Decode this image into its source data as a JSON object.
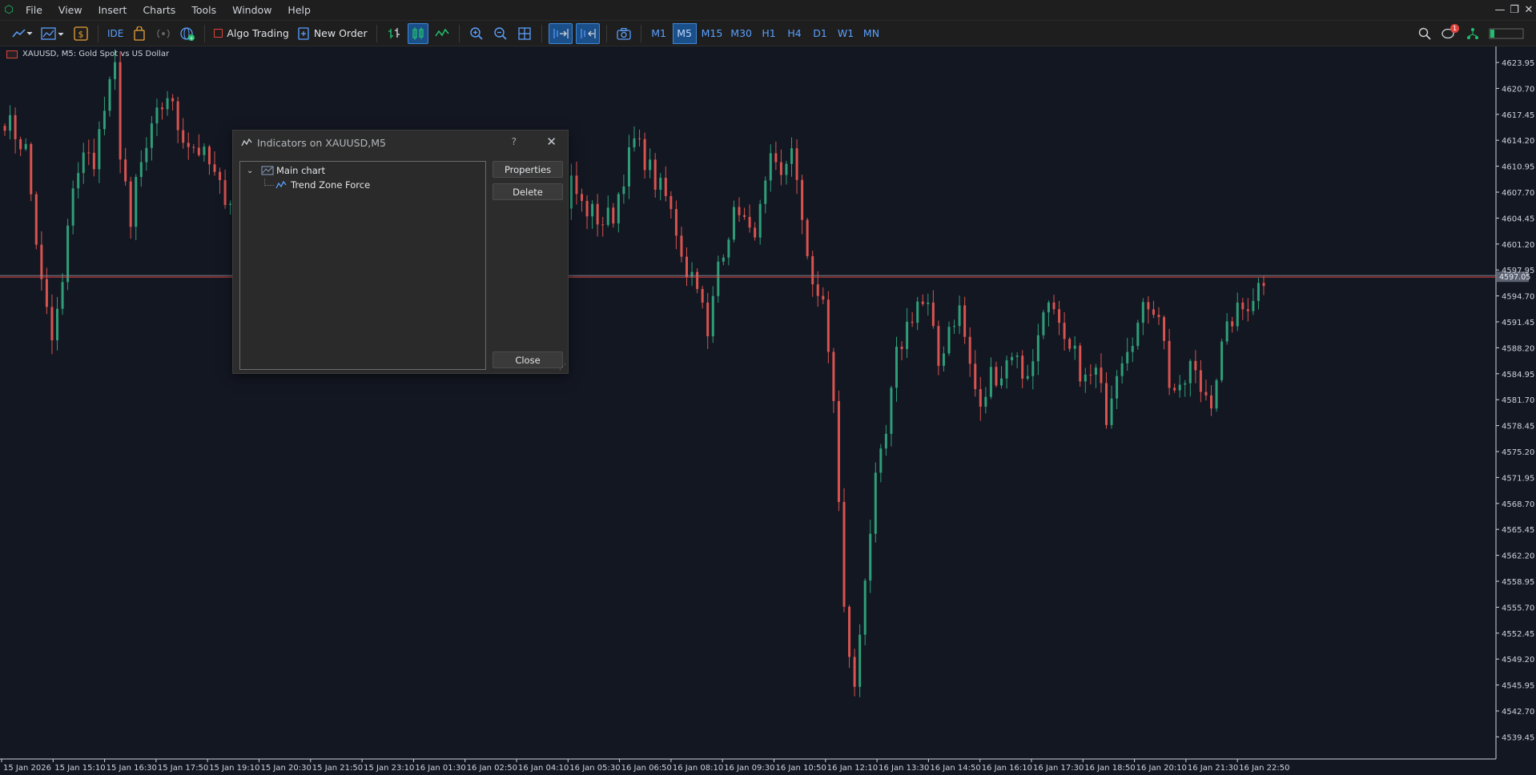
{
  "menubar": {
    "items": [
      "File",
      "View",
      "Insert",
      "Charts",
      "Tools",
      "Window",
      "Help"
    ],
    "window_controls": [
      "—",
      "❐",
      "✕"
    ]
  },
  "toolbar": {
    "ide_label": "IDE",
    "algo_trading_label": "Algo Trading",
    "new_order_label": "New Order",
    "timeframes": [
      "M1",
      "M5",
      "M15",
      "M30",
      "H1",
      "H4",
      "D1",
      "W1",
      "MN"
    ],
    "active_timeframe": "M5",
    "notification_count": "1"
  },
  "chart": {
    "title": "XAUUSD, M5:  Gold Spot vs US Dollar",
    "current_price": "4597.05",
    "price_labels": [
      "4623.95",
      "4620.70",
      "4617.45",
      "4614.20",
      "4610.95",
      "4607.70",
      "4604.45",
      "4601.20",
      "4597.95",
      "4594.70",
      "4591.45",
      "4588.20",
      "4584.95",
      "4581.70",
      "4578.45",
      "4575.20",
      "4571.95",
      "4568.70",
      "4565.45",
      "4562.20",
      "4558.95",
      "4555.70",
      "4552.45",
      "4549.20",
      "4545.95",
      "4542.70",
      "4539.45"
    ],
    "time_labels": [
      "15 Jan 2026",
      "15 Jan 15:10",
      "15 Jan 16:30",
      "15 Jan 17:50",
      "15 Jan 19:10",
      "15 Jan 20:30",
      "15 Jan 21:50",
      "15 Jan 23:10",
      "16 Jan 01:30",
      "16 Jan 02:50",
      "16 Jan 04:10",
      "16 Jan 05:30",
      "16 Jan 06:50",
      "16 Jan 08:10",
      "16 Jan 09:30",
      "16 Jan 10:50",
      "16 Jan 12:10",
      "16 Jan 13:30",
      "16 Jan 14:50",
      "16 Jan 16:10",
      "16 Jan 17:30",
      "16 Jan 18:50",
      "16 Jan 20:10",
      "16 Jan 21:30",
      "16 Jan 22:50"
    ],
    "colors": {
      "bull": "#2f9e78",
      "bear": "#d9534f",
      "background": "#131722",
      "price_line": "#e0433b"
    }
  },
  "chart_data": {
    "type": "candlestick",
    "symbol": "XAUUSD",
    "timeframe": "M5",
    "ylim": [
      4537,
      4626
    ],
    "current_price": 4597.05,
    "path_close": [
      [
        0,
        4617
      ],
      [
        4,
        4613
      ],
      [
        7,
        4596
      ],
      [
        9,
        4589
      ],
      [
        11,
        4596
      ],
      [
        13,
        4609
      ],
      [
        15,
        4612
      ],
      [
        17,
        4612
      ],
      [
        19,
        4618
      ],
      [
        21,
        4623
      ],
      [
        22,
        4613
      ],
      [
        23,
        4609
      ],
      [
        24,
        4602
      ],
      [
        25,
        4609
      ],
      [
        27,
        4613
      ],
      [
        29,
        4617
      ],
      [
        31,
        4620
      ],
      [
        33,
        4616
      ],
      [
        35,
        4614
      ],
      [
        37,
        4613
      ],
      [
        39,
        4611
      ],
      [
        41,
        4608
      ],
      [
        43,
        4607
      ],
      [
        45,
        4604
      ],
      [
        47,
        4602
      ],
      [
        49,
        4603
      ],
      [
        52,
        4598
      ],
      [
        55,
        4597
      ],
      [
        57,
        4598
      ],
      [
        60,
        4600
      ],
      [
        62,
        4598
      ],
      [
        65,
        4599
      ],
      [
        67,
        4601
      ],
      [
        70,
        4599
      ],
      [
        73,
        4597
      ],
      [
        76,
        4595
      ],
      [
        78,
        4592
      ],
      [
        80,
        4596
      ],
      [
        82,
        4611
      ],
      [
        84,
        4608
      ],
      [
        86,
        4605
      ],
      [
        88,
        4597
      ],
      [
        90,
        4599
      ],
      [
        92,
        4607
      ],
      [
        94,
        4609
      ],
      [
        96,
        4607
      ],
      [
        98,
        4605
      ],
      [
        100,
        4603
      ],
      [
        102,
        4602
      ],
      [
        104,
        4601
      ],
      [
        106,
        4604
      ],
      [
        108,
        4609
      ],
      [
        110,
        4606
      ],
      [
        112,
        4605
      ],
      [
        114,
        4604
      ],
      [
        116,
        4605
      ],
      [
        118,
        4610
      ],
      [
        120,
        4614
      ],
      [
        122,
        4612
      ],
      [
        124,
        4609
      ],
      [
        126,
        4607
      ],
      [
        128,
        4603
      ],
      [
        130,
        4598
      ],
      [
        132,
        4597
      ],
      [
        134,
        4589
      ],
      [
        136,
        4599
      ],
      [
        138,
        4603
      ],
      [
        140,
        4606
      ],
      [
        142,
        4602
      ],
      [
        144,
        4605
      ],
      [
        146,
        4611
      ],
      [
        148,
        4609
      ],
      [
        150,
        4614
      ],
      [
        152,
        4603
      ],
      [
        154,
        4597
      ],
      [
        156,
        4593
      ],
      [
        158,
        4582
      ],
      [
        160,
        4555
      ],
      [
        162,
        4545
      ],
      [
        164,
        4560
      ],
      [
        166,
        4571
      ],
      [
        168,
        4577
      ],
      [
        170,
        4587
      ],
      [
        172,
        4591
      ],
      [
        174,
        4594
      ],
      [
        176,
        4593
      ],
      [
        178,
        4586
      ],
      [
        180,
        4591
      ],
      [
        182,
        4593
      ],
      [
        184,
        4586
      ],
      [
        186,
        4580
      ],
      [
        188,
        4585
      ],
      [
        190,
        4585
      ],
      [
        192,
        4588
      ],
      [
        194,
        4585
      ],
      [
        196,
        4586
      ],
      [
        198,
        4594
      ],
      [
        200,
        4592
      ],
      [
        202,
        4588
      ],
      [
        204,
        4587
      ],
      [
        206,
        4584
      ],
      [
        208,
        4585
      ],
      [
        210,
        4580
      ],
      [
        212,
        4586
      ],
      [
        214,
        4589
      ],
      [
        216,
        4591
      ],
      [
        218,
        4594
      ],
      [
        220,
        4593
      ],
      [
        222,
        4584
      ],
      [
        224,
        4582
      ],
      [
        226,
        4586
      ],
      [
        228,
        4583
      ],
      [
        230,
        4582
      ],
      [
        232,
        4588
      ],
      [
        234,
        4592
      ],
      [
        236,
        4593
      ],
      [
        238,
        4595
      ],
      [
        240,
        4597
      ]
    ]
  },
  "dialog": {
    "title": "Indicators on XAUUSD,M5",
    "help": "?",
    "close_x": "✕",
    "tree": {
      "root": "Main chart",
      "child": "Trend Zone Force"
    },
    "buttons": {
      "properties": "Properties",
      "delete": "Delete",
      "close": "Close"
    }
  }
}
